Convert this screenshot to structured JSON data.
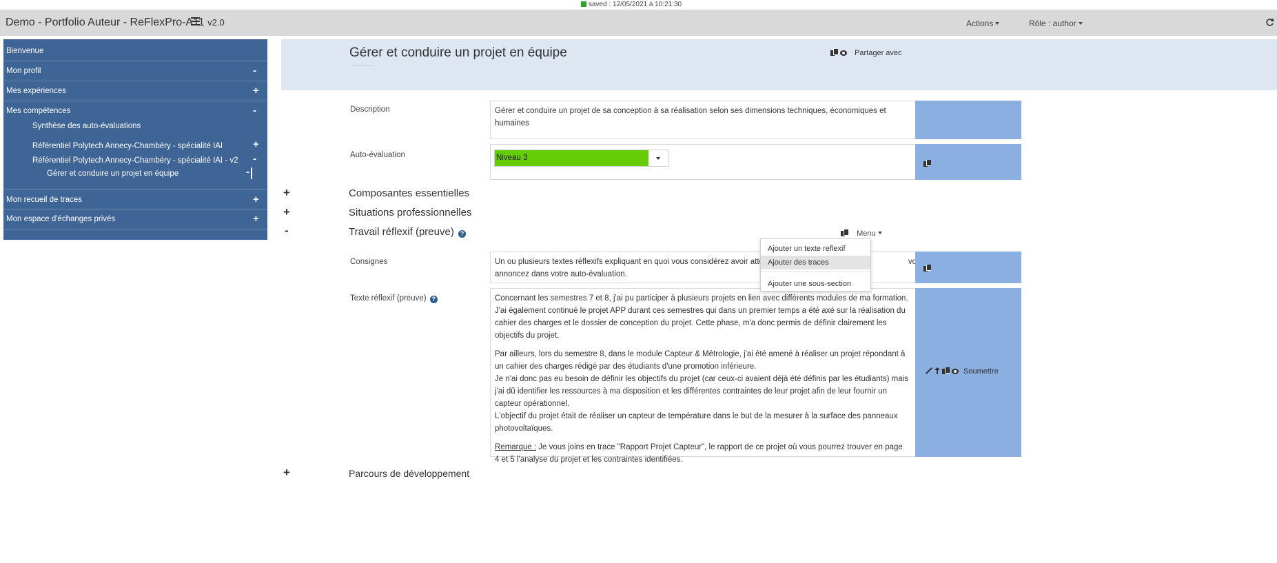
{
  "status": {
    "saved_text": "saved : 12/05/2021 à 10:21:30"
  },
  "header": {
    "title": "Demo - Portfolio Auteur - ReFlexPro-A11 ",
    "version": "v2.0",
    "actions_label": "Actions",
    "role_label": "Rôle : author"
  },
  "sidebar": {
    "items": [
      {
        "label": "Bienvenue",
        "sign": ""
      },
      {
        "label": "Mon profil",
        "sign": "-"
      },
      {
        "label": "Mes expériences",
        "sign": "+"
      },
      {
        "label": "Mes compétences",
        "sign": "-"
      }
    ],
    "sub_items": [
      {
        "label": "Synthèse des auto-évaluations",
        "sign": ""
      },
      {
        "label": "Référentiel Polytech Annecy-Chambéry - spécialité IAI",
        "sign": "+"
      },
      {
        "label": "Référentiel Polytech Annecy-Chambéry - spécialité IAI - v2",
        "sign": "-"
      },
      {
        "label": "Gérer et conduire un projet en équipe",
        "sign": "-"
      }
    ],
    "bottom_items": [
      {
        "label": "Mon recueil de traces",
        "sign": "+"
      },
      {
        "label": "Mon espace d'échanges privés",
        "sign": "+"
      }
    ]
  },
  "page": {
    "title": "Gérer et conduire un projet en équipe",
    "share_label": "Partager avec"
  },
  "description": {
    "label": "Description",
    "text": "Gérer et conduire un projet de sa conception à sa réalisation selon ses dimensions techniques, économiques et humaines"
  },
  "auto_evaluation": {
    "label": "Auto-évaluation",
    "value": "Niveau 3"
  },
  "sections": {
    "composantes": {
      "sign": "+",
      "title": "Composantes essentielles"
    },
    "situations": {
      "sign": "+",
      "title": "Situations professionnelles"
    },
    "travail": {
      "sign": "-",
      "title": "Travail réflexif (preuve)"
    },
    "parcours": {
      "sign": "+",
      "title": "Parcours de développement"
    }
  },
  "menu": {
    "label": "Menu",
    "items": [
      "Ajouter un texte reflexif",
      "Ajouter des traces",
      "Ajouter une sous-section"
    ]
  },
  "consignes": {
    "label": "Consignes",
    "text_before": "Un ou plusieurs textes réflexifs expliquant en quoi vous considérez avoir atteint l",
    "text_after": "vous",
    "text_line2": "annoncez dans votre auto-évaluation."
  },
  "texte_reflexif": {
    "label": "Texte réflexif (preuve)",
    "submit_label": "Soumettre",
    "paragraphs": [
      "Concernant les semestres 7 et 8, j'ai pu participer à plusieurs projets en lien avec différents modules de ma formation. J'ai également continué le projet APP durant ces semestres qui dans un premier temps a été axé sur la réalisation du cahier des charges et le dossier de conception du projet. Cette phase, m'a donc permis de définir clairement les objectifs du projet.",
      "Par ailleurs, lors du semestre 8, dans le module Capteur & Métrologie, j'ai été amené à réaliser un projet répondant à un cahier des charges rédigé par des étudiants d'une promotion inférieure.",
      "Je n'ai donc pas eu besoin de définir les objectifs du projet (car ceux-ci avaient déjà été définis par les étudiants) mais j'ai dû identifier les ressources à ma disposition et les différentes contraintes de leur projet afin de leur fournir un capteur opérationnel.",
      "L'objectif du projet était de réaliser un capteur de température dans le but de la mesurer à la surface des panneaux photovoltaïques."
    ],
    "remark_label": "Remarque :",
    "remark_text": " Je vous joins en trace \"Rapport Projet Capteur\", le rapport de ce projet où vous pourrez trouver en page 4 et 5 l'analyse du projet et les contraintes identifiées."
  },
  "icons": {
    "hamburger": "menu-icon",
    "copy": "copy-icon",
    "eye": "eye-icon",
    "refresh": "refresh-icon",
    "help": "help-icon"
  },
  "colors": {
    "sidebar": "#3f6596",
    "banner": "#dde6f1",
    "side_panel": "#8aafe0",
    "level": "#65cc08",
    "saved": "#2aa52a"
  }
}
